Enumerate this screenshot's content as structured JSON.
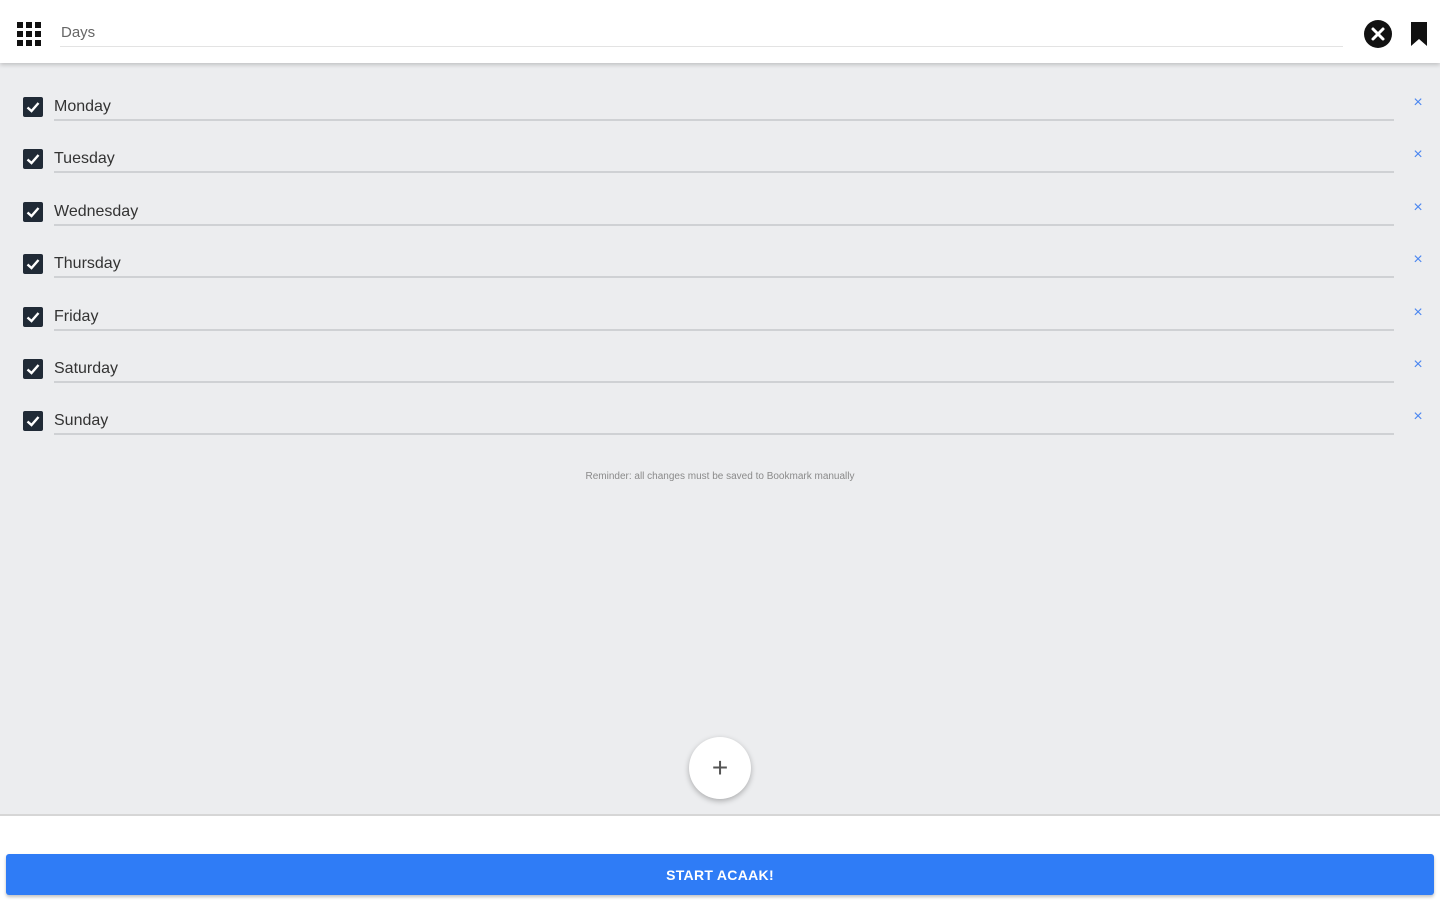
{
  "header": {
    "title_value": "Days",
    "apps_icon": "apps-grid-icon",
    "close_icon": "close-circle-icon",
    "bookmark_icon": "bookmark-icon"
  },
  "days": [
    {
      "label": "Monday",
      "checked": true
    },
    {
      "label": "Tuesday",
      "checked": true
    },
    {
      "label": "Wednesday",
      "checked": true
    },
    {
      "label": "Thursday",
      "checked": true
    },
    {
      "label": "Friday",
      "checked": true
    },
    {
      "label": "Saturday",
      "checked": true
    },
    {
      "label": "Sunday",
      "checked": true
    }
  ],
  "row_remove_symbol": "×",
  "reminder": "Reminder: all changes must be saved to Bookmark manually",
  "fab_symbol": "+",
  "footer": {
    "start_label": "START ACAAK!"
  },
  "colors": {
    "accent": "#2f7cf6",
    "checkbox": "#202a36",
    "background": "#ecedef",
    "remove_x": "#4a86f0"
  }
}
